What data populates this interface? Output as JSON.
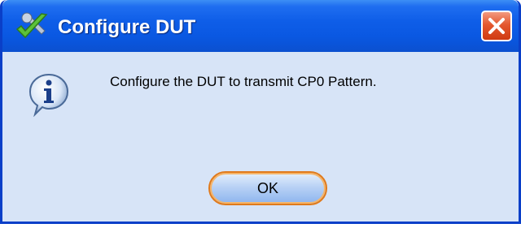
{
  "window": {
    "title": "Configure DUT",
    "app_icon": "checkmark-wrench-icon",
    "close_icon": "close-icon"
  },
  "dialog": {
    "icon": "info-icon",
    "message": "Configure the DUT to transmit CP0 Pattern.",
    "ok_label": "OK"
  },
  "colors": {
    "titlebar": "#0a58e2",
    "window_body": "#d7e4f7",
    "close_button": "#e4582f",
    "ok_border": "#e07a1c"
  }
}
